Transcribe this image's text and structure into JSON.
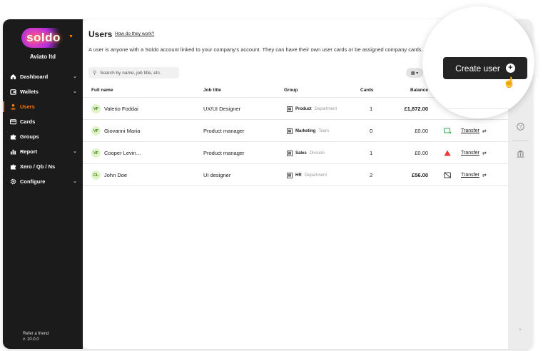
{
  "sidebar": {
    "logo": "soldo",
    "company": "Aviato ltd",
    "items": [
      {
        "label": "Dashboard",
        "icon": "home-icon",
        "chevron": true,
        "active": false
      },
      {
        "label": "Wallets",
        "icon": "wallet-icon",
        "chevron": true,
        "active": false
      },
      {
        "label": "Users",
        "icon": "user-icon",
        "chevron": false,
        "active": true
      },
      {
        "label": "Cards",
        "icon": "card-icon",
        "chevron": false,
        "active": false
      },
      {
        "label": "Groups",
        "icon": "puzzle-icon",
        "chevron": false,
        "active": false
      },
      {
        "label": "Report",
        "icon": "chart-icon",
        "chevron": true,
        "active": false
      },
      {
        "label": "Xero / Qb / Ns",
        "icon": "puzzle-icon",
        "chevron": false,
        "active": false
      },
      {
        "label": "Configure",
        "icon": "gear-icon",
        "chevron": true,
        "active": false
      }
    ],
    "refer_label": "Refer a friend",
    "version": "v. 10.0.0"
  },
  "header": {
    "title": "Users",
    "help_link": "How do they work?",
    "description": "A user is anyone with a Soldo account linked to your company's account. They can have their own user cards or be assigned company cards."
  },
  "search": {
    "placeholder": "Search by name, job title, etc."
  },
  "table": {
    "columns": [
      "Full name",
      "Job title",
      "Group",
      "Cards",
      "Balance"
    ],
    "rows": [
      {
        "initials": "VF",
        "name": "Valerio Foddai",
        "job": "UX/UI Designer",
        "group": "Product",
        "group_type": "Department",
        "cards": "1",
        "balance": "£1,872.00",
        "balance_bold": true,
        "status_icon": "",
        "transfer": ""
      },
      {
        "initials": "VF",
        "name": "Giovanni Maria",
        "job": "Product manager",
        "group": "Marketing",
        "group_type": "Team",
        "cards": "0",
        "balance": "£0.00",
        "balance_bold": false,
        "status_icon": "card-add-icon",
        "transfer": "Transfer"
      },
      {
        "initials": "VF",
        "name": "Cooper Levin…",
        "job": "Product manager",
        "group": "Sales",
        "group_type": "Division",
        "cards": "1",
        "balance": "£0.00",
        "balance_bold": false,
        "status_icon": "warning-icon",
        "transfer": "Transfer"
      },
      {
        "initials": "CL",
        "name": "John Doe",
        "job": "UI designer",
        "group": "HR",
        "group_type": "Department",
        "cards": "2",
        "balance": "£56.00",
        "balance_bold": true,
        "status_icon": "card-blocked-icon",
        "transfer": "Transfer"
      }
    ]
  },
  "create_button": {
    "label": "Create user"
  },
  "colors": {
    "accent": "#ff7a00",
    "sidebar_bg": "#1b1b1b",
    "button_bg": "#242424",
    "warning": "#e53935",
    "card_add": "#2fa84f"
  }
}
